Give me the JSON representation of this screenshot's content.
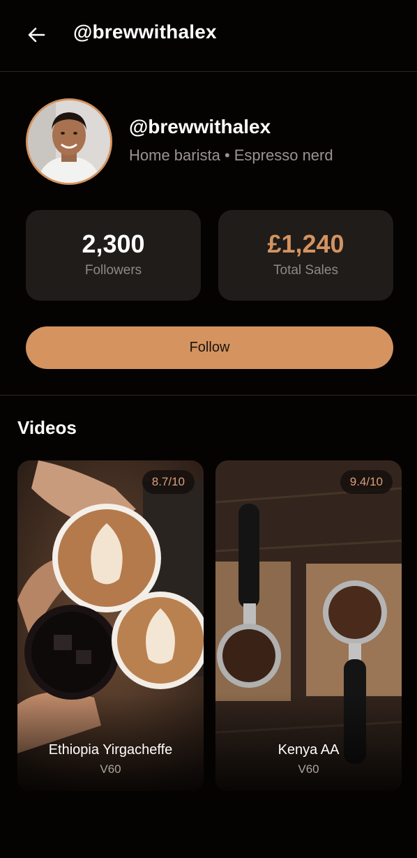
{
  "header": {
    "title": "@brewwithalex",
    "back_icon": "arrow-left-icon"
  },
  "profile": {
    "handle": "@brewwithalex",
    "bio": "Home barista • Espresso nerd",
    "stats": [
      {
        "value": "2,300",
        "label": "Followers"
      },
      {
        "value": "£1,240",
        "label": "Total Sales"
      }
    ],
    "follow_label": "Follow"
  },
  "colors": {
    "accent": "#d4935f",
    "background": "#050302",
    "card": "#1f1c1a"
  },
  "videos": {
    "title": "Videos",
    "items": [
      {
        "rating": "8.7/10",
        "title": "Ethiopia Yirgacheffe",
        "method": "V60"
      },
      {
        "rating": "9.4/10",
        "title": "Kenya AA",
        "method": "V60"
      }
    ]
  }
}
